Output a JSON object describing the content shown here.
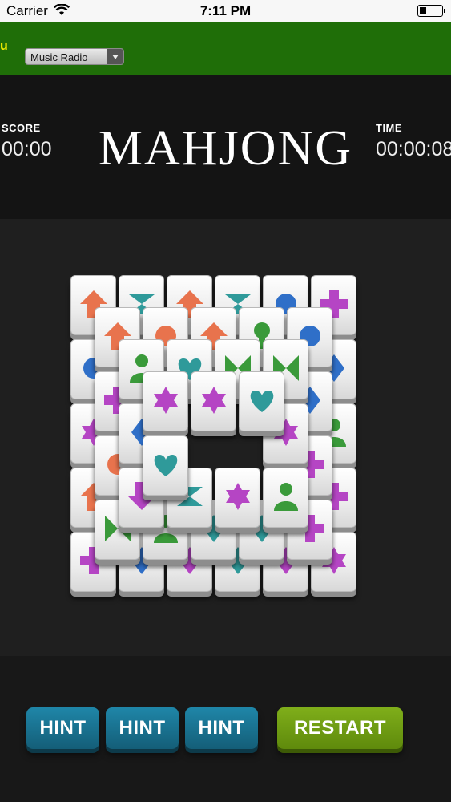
{
  "status_bar": {
    "carrier": "Carrier",
    "time": "7:11 PM"
  },
  "toolbar": {
    "edge_text": "u",
    "radio_select": "Music Radio"
  },
  "game": {
    "title": "MAHJONG",
    "score_label": "SCORE",
    "score_value": "00:00",
    "time_label": "TIME",
    "time_value": "00:00:08"
  },
  "colors": {
    "orange": "#e8734d",
    "teal": "#2f9a9a",
    "blue": "#2f6fc8",
    "green": "#3a9a3a",
    "purple": "#b545c4",
    "header_green": "#1f6e08"
  },
  "tiles": [
    {
      "layer": 0,
      "col": 0,
      "row": 0,
      "symbol": "arrow",
      "color": "orange"
    },
    {
      "layer": 0,
      "col": 1,
      "row": 0,
      "symbol": "bowtie-v",
      "color": "teal"
    },
    {
      "layer": 0,
      "col": 2,
      "row": 0,
      "symbol": "arrow",
      "color": "orange"
    },
    {
      "layer": 0,
      "col": 3,
      "row": 0,
      "symbol": "bowtie-v",
      "color": "teal"
    },
    {
      "layer": 0,
      "col": 4,
      "row": 0,
      "symbol": "circle",
      "color": "blue"
    },
    {
      "layer": 0,
      "col": 5,
      "row": 0,
      "symbol": "cross",
      "color": "purple"
    },
    {
      "layer": 0,
      "col": 0,
      "row": 1,
      "symbol": "circle",
      "color": "blue"
    },
    {
      "layer": 0,
      "col": 5,
      "row": 1,
      "symbol": "diamond",
      "color": "blue"
    },
    {
      "layer": 0,
      "col": 0,
      "row": 2,
      "symbol": "star",
      "color": "purple"
    },
    {
      "layer": 0,
      "col": 5,
      "row": 2,
      "symbol": "person",
      "color": "green"
    },
    {
      "layer": 0,
      "col": 0,
      "row": 3,
      "symbol": "arrow",
      "color": "orange"
    },
    {
      "layer": 0,
      "col": 5,
      "row": 3,
      "symbol": "cross",
      "color": "purple"
    },
    {
      "layer": 0,
      "col": 0,
      "row": 4,
      "symbol": "cross",
      "color": "purple"
    },
    {
      "layer": 0,
      "col": 1,
      "row": 4,
      "symbol": "diamond",
      "color": "blue"
    },
    {
      "layer": 0,
      "col": 2,
      "row": 4,
      "symbol": "diamond",
      "color": "purple"
    },
    {
      "layer": 0,
      "col": 3,
      "row": 4,
      "symbol": "diamond",
      "color": "teal"
    },
    {
      "layer": 0,
      "col": 4,
      "row": 4,
      "symbol": "diamond",
      "color": "purple"
    },
    {
      "layer": 0,
      "col": 5,
      "row": 4,
      "symbol": "star",
      "color": "purple"
    },
    {
      "layer": 1,
      "col": 0,
      "row": 0,
      "symbol": "arrow",
      "color": "orange"
    },
    {
      "layer": 1,
      "col": 1,
      "row": 0,
      "symbol": "circle",
      "color": "orange"
    },
    {
      "layer": 1,
      "col": 2,
      "row": 0,
      "symbol": "arrow",
      "color": "orange"
    },
    {
      "layer": 1,
      "col": 3,
      "row": 0,
      "symbol": "pin",
      "color": "green"
    },
    {
      "layer": 1,
      "col": 4,
      "row": 0,
      "symbol": "circle",
      "color": "blue"
    },
    {
      "layer": 1,
      "col": 0,
      "row": 1,
      "symbol": "cross",
      "color": "purple"
    },
    {
      "layer": 1,
      "col": 4,
      "row": 1,
      "symbol": "diamond",
      "color": "blue"
    },
    {
      "layer": 1,
      "col": 0,
      "row": 2,
      "symbol": "circle",
      "color": "orange"
    },
    {
      "layer": 1,
      "col": 4,
      "row": 2,
      "symbol": "cross",
      "color": "purple"
    },
    {
      "layer": 1,
      "col": 0,
      "row": 3,
      "symbol": "bowtie-h",
      "color": "green"
    },
    {
      "layer": 1,
      "col": 1,
      "row": 3,
      "symbol": "person",
      "color": "green"
    },
    {
      "layer": 1,
      "col": 2,
      "row": 3,
      "symbol": "diamond",
      "color": "teal"
    },
    {
      "layer": 1,
      "col": 3,
      "row": 3,
      "symbol": "diamond",
      "color": "teal"
    },
    {
      "layer": 1,
      "col": 4,
      "row": 3,
      "symbol": "cross",
      "color": "purple"
    },
    {
      "layer": 2,
      "col": 0,
      "row": 0,
      "symbol": "person",
      "color": "green"
    },
    {
      "layer": 2,
      "col": 1,
      "row": 0,
      "symbol": "heart",
      "color": "teal"
    },
    {
      "layer": 2,
      "col": 2,
      "row": 0,
      "symbol": "bowtie-h",
      "color": "green"
    },
    {
      "layer": 2,
      "col": 3,
      "row": 0,
      "symbol": "bowtie-h",
      "color": "green"
    },
    {
      "layer": 2,
      "col": 0,
      "row": 1,
      "symbol": "diamond",
      "color": "blue"
    },
    {
      "layer": 2,
      "col": 3,
      "row": 1,
      "symbol": "star",
      "color": "purple"
    },
    {
      "layer": 2,
      "col": 0,
      "row": 2,
      "symbol": "arrow-down",
      "color": "purple"
    },
    {
      "layer": 2,
      "col": 1,
      "row": 2,
      "symbol": "bowtie-v",
      "color": "teal"
    },
    {
      "layer": 2,
      "col": 2,
      "row": 2,
      "symbol": "star",
      "color": "purple"
    },
    {
      "layer": 2,
      "col": 3,
      "row": 2,
      "symbol": "person",
      "color": "green"
    },
    {
      "layer": 3,
      "col": 0,
      "row": 0,
      "symbol": "star",
      "color": "purple"
    },
    {
      "layer": 3,
      "col": 1,
      "row": 0,
      "symbol": "star",
      "color": "purple"
    },
    {
      "layer": 3,
      "col": 2,
      "row": 0,
      "symbol": "heart",
      "color": "teal"
    },
    {
      "layer": 3,
      "col": 0,
      "row": 1,
      "symbol": "heart",
      "color": "teal"
    }
  ],
  "buttons": [
    {
      "label": "HINT",
      "kind": "hint"
    },
    {
      "label": "HINT",
      "kind": "hint"
    },
    {
      "label": "HINT",
      "kind": "hint"
    },
    {
      "label": "RESTART",
      "kind": "restart"
    }
  ]
}
